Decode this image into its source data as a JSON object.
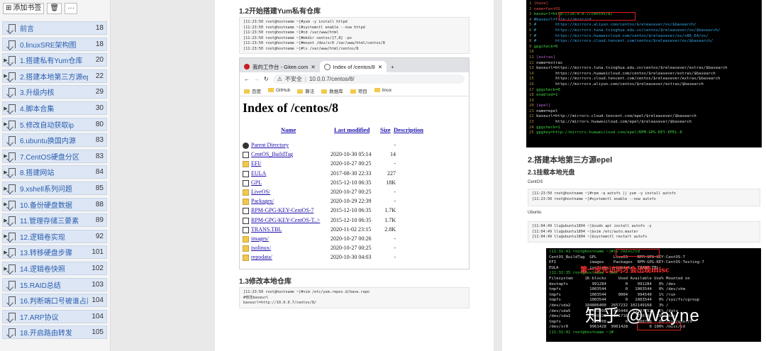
{
  "sidebar": {
    "add_bookmark_label": "添加书签",
    "more_label": "···",
    "items": [
      {
        "label": "前言",
        "page": "18",
        "expandable": false
      },
      {
        "label": "0.linuxSRE架构图",
        "page": "18",
        "expandable": false
      },
      {
        "label": "1.搭建私有Yum仓库",
        "page": "20",
        "expandable": true
      },
      {
        "label": "2.搭建本地第三方源epel",
        "page": "22",
        "expandable": true
      },
      {
        "label": "3.升级内核",
        "page": "29",
        "expandable": false
      },
      {
        "label": "4.脚本合集",
        "page": "30",
        "expandable": true
      },
      {
        "label": "5.修改自动获取ip",
        "page": "80",
        "expandable": true
      },
      {
        "label": "6.ubuntu换国内源",
        "page": "83",
        "expandable": false
      },
      {
        "label": "7.CentOS硬盘分区",
        "page": "83",
        "expandable": true
      },
      {
        "label": "8.搭建网站",
        "page": "84",
        "expandable": true
      },
      {
        "label": "9.xshell系列问题",
        "page": "85",
        "expandable": true
      },
      {
        "label": "10.备份硬盘数据",
        "page": "88",
        "expandable": true
      },
      {
        "label": "11.管理存储三要素",
        "page": "89",
        "expandable": true
      },
      {
        "label": "12.逻辑卷实现",
        "page": "92",
        "expandable": true
      },
      {
        "label": "13.转移硬盘步骤",
        "page": "101",
        "expandable": true
      },
      {
        "label": "14.逻辑卷快照",
        "page": "102",
        "expandable": true
      },
      {
        "label": "15.RAID总结",
        "page": "103",
        "expandable": false
      },
      {
        "label": "16.判断端口号被谁占用",
        "page": "104",
        "expandable": false
      },
      {
        "label": "17.ARP协议",
        "page": "104",
        "expandable": false
      },
      {
        "label": "18.开启路由转发",
        "page": "105",
        "expandable": false
      }
    ]
  },
  "left_page": {
    "section1_title": "1.2开始搭建Yum私有仓库",
    "code1": "[11:23:50 root@hostname ~]#yum -y install httpd\n[11:23:50 root@hostname ~]#systemctl enable --now httpd\n[11:23:50 root@hostname ~]#cd /var/www/html\n[11:23:50 root@hostname ~]#mkdir centos/{7,8} -pv\n[11:23:50 root@hostname ~]#mount /dev/sr0 /var/www/html/centos/8\n[11:23:50 root@hostname ~]#ls /var/www/html/centos/8",
    "section2_title": "1.3修改本地仓库",
    "code2": "[11:23:50 root@hostname ~]#vim /etc/yum.repos.d/base.repo\n#修改baseurl\nbaseurl=http://10.0.0.7/centos/8/",
    "browser": {
      "tab1": "我的工作台 - Gitee.com",
      "tab2": "Index of /centos/8",
      "tab_new": "+",
      "url_warning": "不安全",
      "url": "10.0.0.7/centos/8/",
      "bookmarks": [
        "百度",
        "GitHub",
        "算法",
        "数据库",
        "项目",
        "linux"
      ],
      "heading": "Index of /centos/8",
      "col_name": "Name",
      "col_modified": "Last modified",
      "col_size": "Size",
      "col_desc": "Description",
      "rows": [
        {
          "name": "Parent Directory",
          "date": "",
          "size": "-",
          "icon": "parent"
        },
        {
          "name": "CentOS_BuildTag",
          "date": "2020-10-30 05:14",
          "size": "14",
          "icon": "file"
        },
        {
          "name": "EFI/",
          "date": "2020-10-27 00:25",
          "size": "-",
          "icon": "folder"
        },
        {
          "name": "EULA",
          "date": "2017-08-30 22:33",
          "size": "227",
          "icon": "file"
        },
        {
          "name": "GPL",
          "date": "2015-12-10 06:35",
          "size": "18K",
          "icon": "file"
        },
        {
          "name": "LiveOS/",
          "date": "2020-10-27 00:25",
          "size": "-",
          "icon": "folder"
        },
        {
          "name": "Packages/",
          "date": "2020-10-29 22:39",
          "size": "-",
          "icon": "folder"
        },
        {
          "name": "RPM-GPG-KEY-CentOS-7",
          "date": "2015-12-10 06:35",
          "size": "1.7K",
          "icon": "file"
        },
        {
          "name": "RPM-GPG-KEY-CentOS-T..>",
          "date": "2015-12-10 06:35",
          "size": "1.7K",
          "icon": "file"
        },
        {
          "name": "TRANS.TBL",
          "date": "2020-11-02 23:15",
          "size": "2.8K",
          "icon": "file"
        },
        {
          "name": "images/",
          "date": "2020-10-27 00:26",
          "size": "-",
          "icon": "folder"
        },
        {
          "name": "isolinux/",
          "date": "2020-10-27 00:25",
          "size": "-",
          "icon": "folder"
        },
        {
          "name": "repodata/",
          "date": "2020-10-30 04:03",
          "size": "-",
          "icon": "folder"
        }
      ]
    }
  },
  "right_page": {
    "terminal1_lines": [
      {
        "n": "1",
        "t": "[base]",
        "cls": "r"
      },
      {
        "n": "2",
        "t": "name=CentOS",
        "cls": "r"
      },
      {
        "n": "3",
        "t": "baseurl=http://10.0.0.7/centos/8/",
        "cls": "g"
      },
      {
        "n": "4",
        "t": "#baseurl=file:///misc/cd",
        "cls": "c"
      },
      {
        "n": "5",
        "t": "#        https://mirrors.aliyun.com/centos/$releasever/os/$basearch/",
        "cls": "c"
      },
      {
        "n": "6",
        "t": "#        https://mirrors.tuna.tsinghua.edu.cn/centos/$releasever/os/$basearch/",
        "cls": "c"
      },
      {
        "n": "7",
        "t": "#        https://mirrors.huaweicloud.com/centos/$releasever/os/x86_64/os/",
        "cls": "c"
      },
      {
        "n": "8",
        "t": "#        https://mirrors.cloud.tencent.com/centos/$releasever/os/$basearch/",
        "cls": "c"
      },
      {
        "n": "9",
        "t": "gpgcheck=0",
        "cls": "g"
      },
      {
        "n": "10",
        "t": "",
        "cls": ""
      },
      {
        "n": "11",
        "t": "[extras]",
        "cls": "p"
      },
      {
        "n": "12",
        "t": "name=extras",
        "cls": ""
      },
      {
        "n": "13",
        "t": "baseurl=https://mirrors.tuna.tsinghua.edu.cn/centos/$releasever/extras/$basearch",
        "cls": ""
      },
      {
        "n": "14",
        "t": "        https://mirrors.huaweicloud.com/centos/$releasever/extras/$basearch",
        "cls": ""
      },
      {
        "n": "15",
        "t": "        https://mirrors.cloud.tencent.com/centos/$releasever/extras/$basearch",
        "cls": ""
      },
      {
        "n": "16",
        "t": "        https://mirrors.aliyun.com/centos/$releasever/extras/$basearch",
        "cls": ""
      },
      {
        "n": "17",
        "t": "gpgcheck=0",
        "cls": "g"
      },
      {
        "n": "18",
        "t": "enabled=1",
        "cls": "g"
      },
      {
        "n": "19",
        "t": "",
        "cls": ""
      },
      {
        "n": "20",
        "t": "[epel]",
        "cls": "p"
      },
      {
        "n": "21",
        "t": "name=epel",
        "cls": ""
      },
      {
        "n": "22",
        "t": "baseurl=http://mirrors.cloud.tencent.com/epel/$releasever/$basearch",
        "cls": ""
      },
      {
        "n": "23",
        "t": "        http://mirrors.huaweicloud.com/epel/$releasever/$basearch",
        "cls": ""
      },
      {
        "n": "24",
        "t": "gpgcheck=1",
        "cls": "g"
      },
      {
        "n": "25",
        "t": "gpgkey=http://mirrors.huaweicloud.com/epel/RPM-GPG-KEY-EPEL-8",
        "cls": "g"
      }
    ],
    "section_title": "2.搭建本地第三方源epel",
    "subsection_title": "2.1挂载本地光盘",
    "label_centos": "CentOS",
    "code_centos": "[11:23:50 root@hostname ~]#rpm -q autofs || yum -y install autofs\n[11:23:50 root@hostname ~]#systemctl enable --now autofs",
    "label_ubuntu": "Ubuntu",
    "code_ubuntu": "[11:04:49 llu@ubuntu1804 ~]$sudo apt install autofs -y\n[11:04:49 llu@ubuntu1804 ~]$vim /etc/auto.master\n[11:04:49 llu@ubuntu1804 ~]$systemctl restart autofs",
    "terminal2_lines": [
      "[11:31:41 root@hostname ~]#ls /misc/cd",
      "CentOS_BuildTag  GPL       LiveOS    RPM-GPG-KEY-CentOS-7",
      "EFI              images    Packages  RPM-GPG-KEY-CentOS-Testing-7",
      "EULA             isolinux  repodata  TRANS.TBL",
      "[11:32:35 root@hostname ~]#df",
      "Filesystem     1K-blocks     Used Available Use% Mounted on",
      "devtmpfs          991284        0    991284   0% /dev",
      "tmpfs            1003544        0   1003544   0% /dev/shm",
      "tmpfs            1003544     9004    994540   1% /run",
      "tmpfs            1003544        0   1003544   0% /sys/fs/cgroup",
      "/dev/sda2      104806400  2657232 102149168   3% /",
      "/dev/sda5       52403200   405448  51997752   1% /data",
      "/dev/sda1         999320   171716    758792  19% /boot",
      "tmpfs             200708        0    200708   0% /run/user/0",
      "/dev/sr0         9961428  9961428         0 100% /misc/cd",
      "[11:32:41 root@hostname ~]#"
    ],
    "annotation": "第一步先访问才会出现misc",
    "watermark": "知乎 @Wayne"
  }
}
